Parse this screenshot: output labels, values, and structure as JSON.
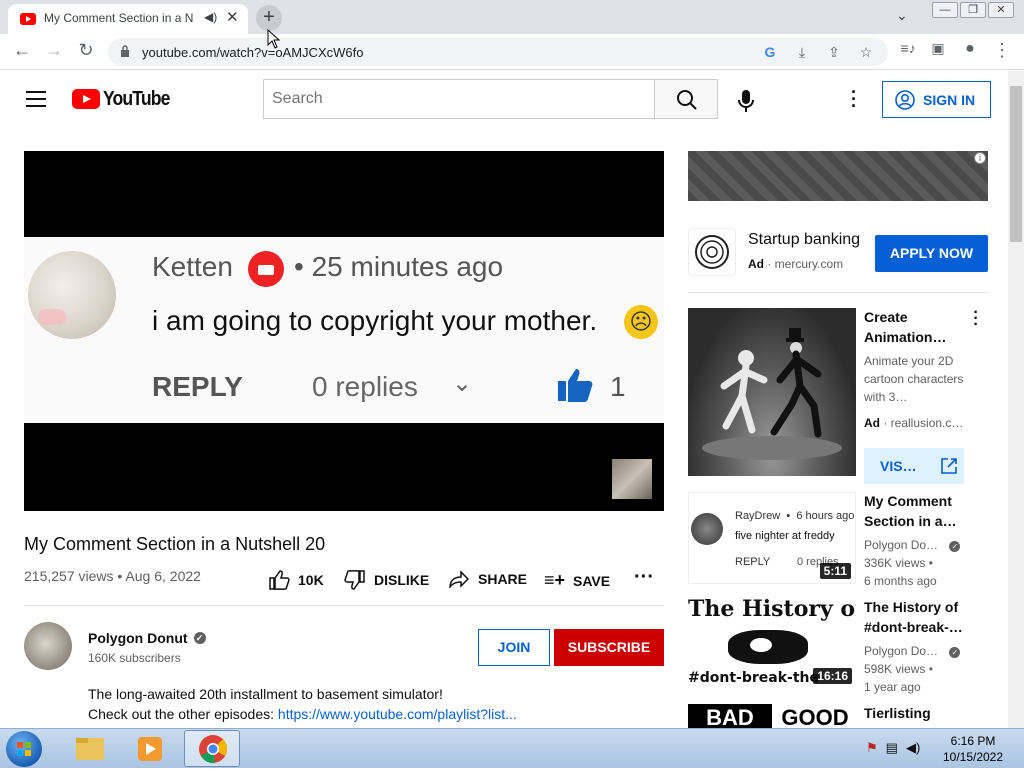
{
  "browser": {
    "tab_title": "My Comment Section in a N",
    "url": "youtube.com/watch?v=oAMJCXcW6fo"
  },
  "header": {
    "logo_text": "YouTube",
    "search_placeholder": "Search",
    "sign_in": "SIGN IN"
  },
  "video": {
    "frame_name": "Ketten",
    "frame_time": "25 minutes ago",
    "frame_comment": "i am going to copyright your mother.",
    "frame_reply": "REPLY",
    "frame_replies": "0 replies",
    "frame_likes": "1",
    "title": "My Comment Section in a Nutshell 20",
    "meta": "215,257 views • Aug 6, 2022",
    "like_count": "10K",
    "dislike": "DISLIKE",
    "share": "SHARE",
    "save": "SAVE"
  },
  "channel": {
    "name": "Polygon Donut",
    "subs": "160K subscribers",
    "join": "JOIN",
    "subscribe": "SUBSCRIBE",
    "desc_line1": "The long-awaited 20th installment to basement simulator!",
    "desc_line2_prefix": "Check out the other episodes: ",
    "desc_link": "https://www.youtube.com/playlist?list..."
  },
  "sidebar": {
    "ad1": {
      "title": "Startup banking",
      "ad_label": "Ad",
      "domain": "mercury.com",
      "cta": "APPLY NOW"
    },
    "ad2": {
      "title": "Create Animation…",
      "desc": "Animate your 2D cartoon characters with 3…",
      "ad_label": "Ad",
      "domain": "reallusion.c…",
      "cta": "VIS…"
    },
    "videos": [
      {
        "title": "My Comment Section in a…",
        "channel": "Polygon Do…",
        "views": "336K views •",
        "age": "6 months ago",
        "duration": "5:11",
        "thumb_user": "RayDrew",
        "thumb_time": "6 hours ago",
        "thumb_comment": "five nighter at freddy",
        "thumb_reply": "REPLY",
        "thumb_replies": "0 replies"
      },
      {
        "title": "The History of #dont-break-…",
        "channel": "Polygon Do…",
        "views": "598K views •",
        "age": "1 year ago",
        "duration": "16:16",
        "thumb_top": "The History of",
        "thumb_bottom": "#dont-break-the-"
      },
      {
        "title": "Tierlisting",
        "thumb_left": "BAD",
        "thumb_right": "GOOD"
      }
    ]
  },
  "taskbar": {
    "time": "6:16 PM",
    "date": "10/15/2022"
  }
}
